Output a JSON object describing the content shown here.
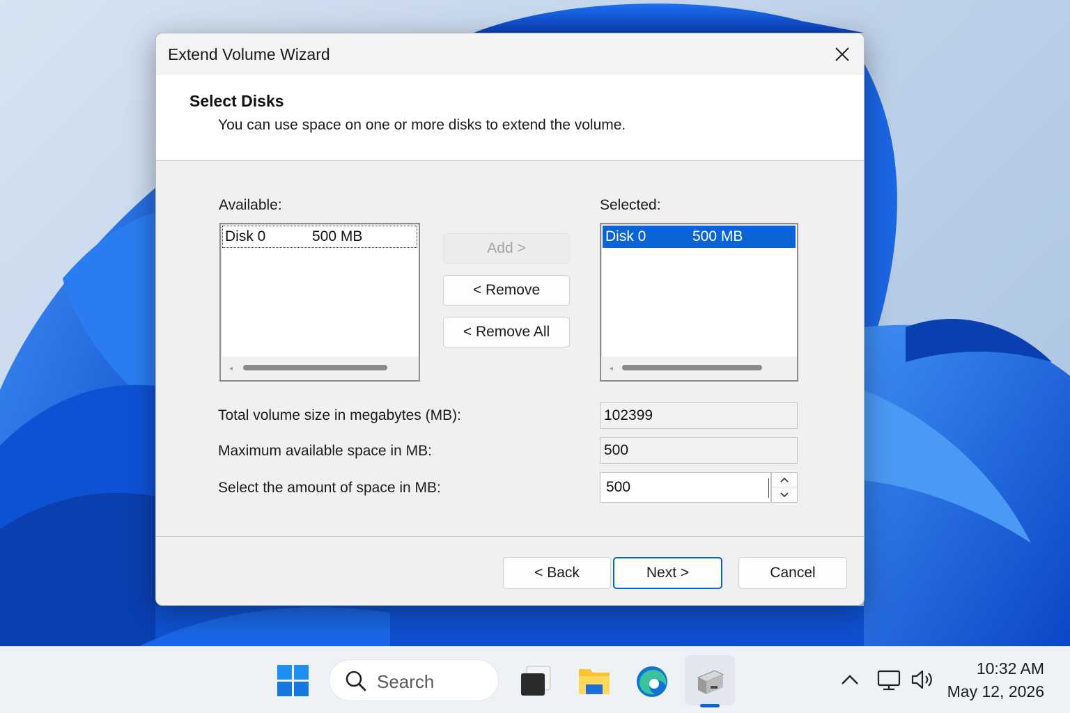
{
  "dialog": {
    "title": "Extend Volume Wizard",
    "header": {
      "title": "Select Disks",
      "subtitle": "You can use space on one or more disks to extend the volume."
    },
    "available": {
      "label": "Available:",
      "items": [
        {
          "disk": "Disk 0",
          "size": "500 MB"
        }
      ]
    },
    "selected": {
      "label": "Selected:",
      "items": [
        {
          "disk": "Disk 0",
          "size": "500 MB"
        }
      ]
    },
    "buttons": {
      "add": "Add >",
      "remove": "< Remove",
      "remove_all": "< Remove All",
      "back": "< Back",
      "next": "Next >",
      "cancel": "Cancel"
    },
    "fields": {
      "total_label": "Total volume size in megabytes (MB):",
      "total_value": "102399",
      "max_label": "Maximum available space in MB:",
      "max_value": "500",
      "amount_label": "Select the amount of space in MB:",
      "amount_value": "500"
    }
  },
  "taskbar": {
    "search_placeholder": "Search",
    "icons": [
      "start-icon",
      "search-icon",
      "task-view-icon",
      "file-explorer-icon",
      "edge-icon",
      "disk-management-icon"
    ],
    "tray_icons": [
      "chevron-up-icon",
      "network-icon",
      "volume-icon"
    ],
    "time": "10:32 AM",
    "date": "May 12, 2026"
  },
  "colors": {
    "accent": "#0a64d8",
    "selection": "#0a64d8",
    "wallpaper_blue": "#1565e0"
  }
}
